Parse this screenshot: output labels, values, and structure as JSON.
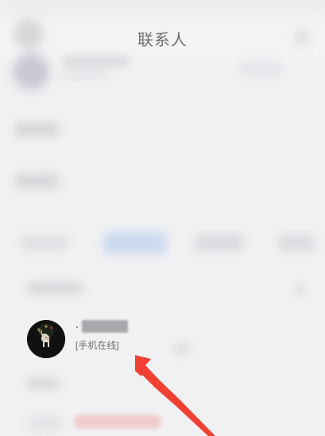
{
  "header": {
    "title": "联系人"
  },
  "contacts": [
    {
      "status": "[手机在线]"
    }
  ],
  "icons": {
    "avatar": "deer-avatar",
    "annotation": "red-arrow"
  },
  "colors": {
    "background": "#f1f1f3",
    "title_text": "#6e6e72",
    "status_text": "#6f6f73",
    "arrow": "#f04034"
  }
}
